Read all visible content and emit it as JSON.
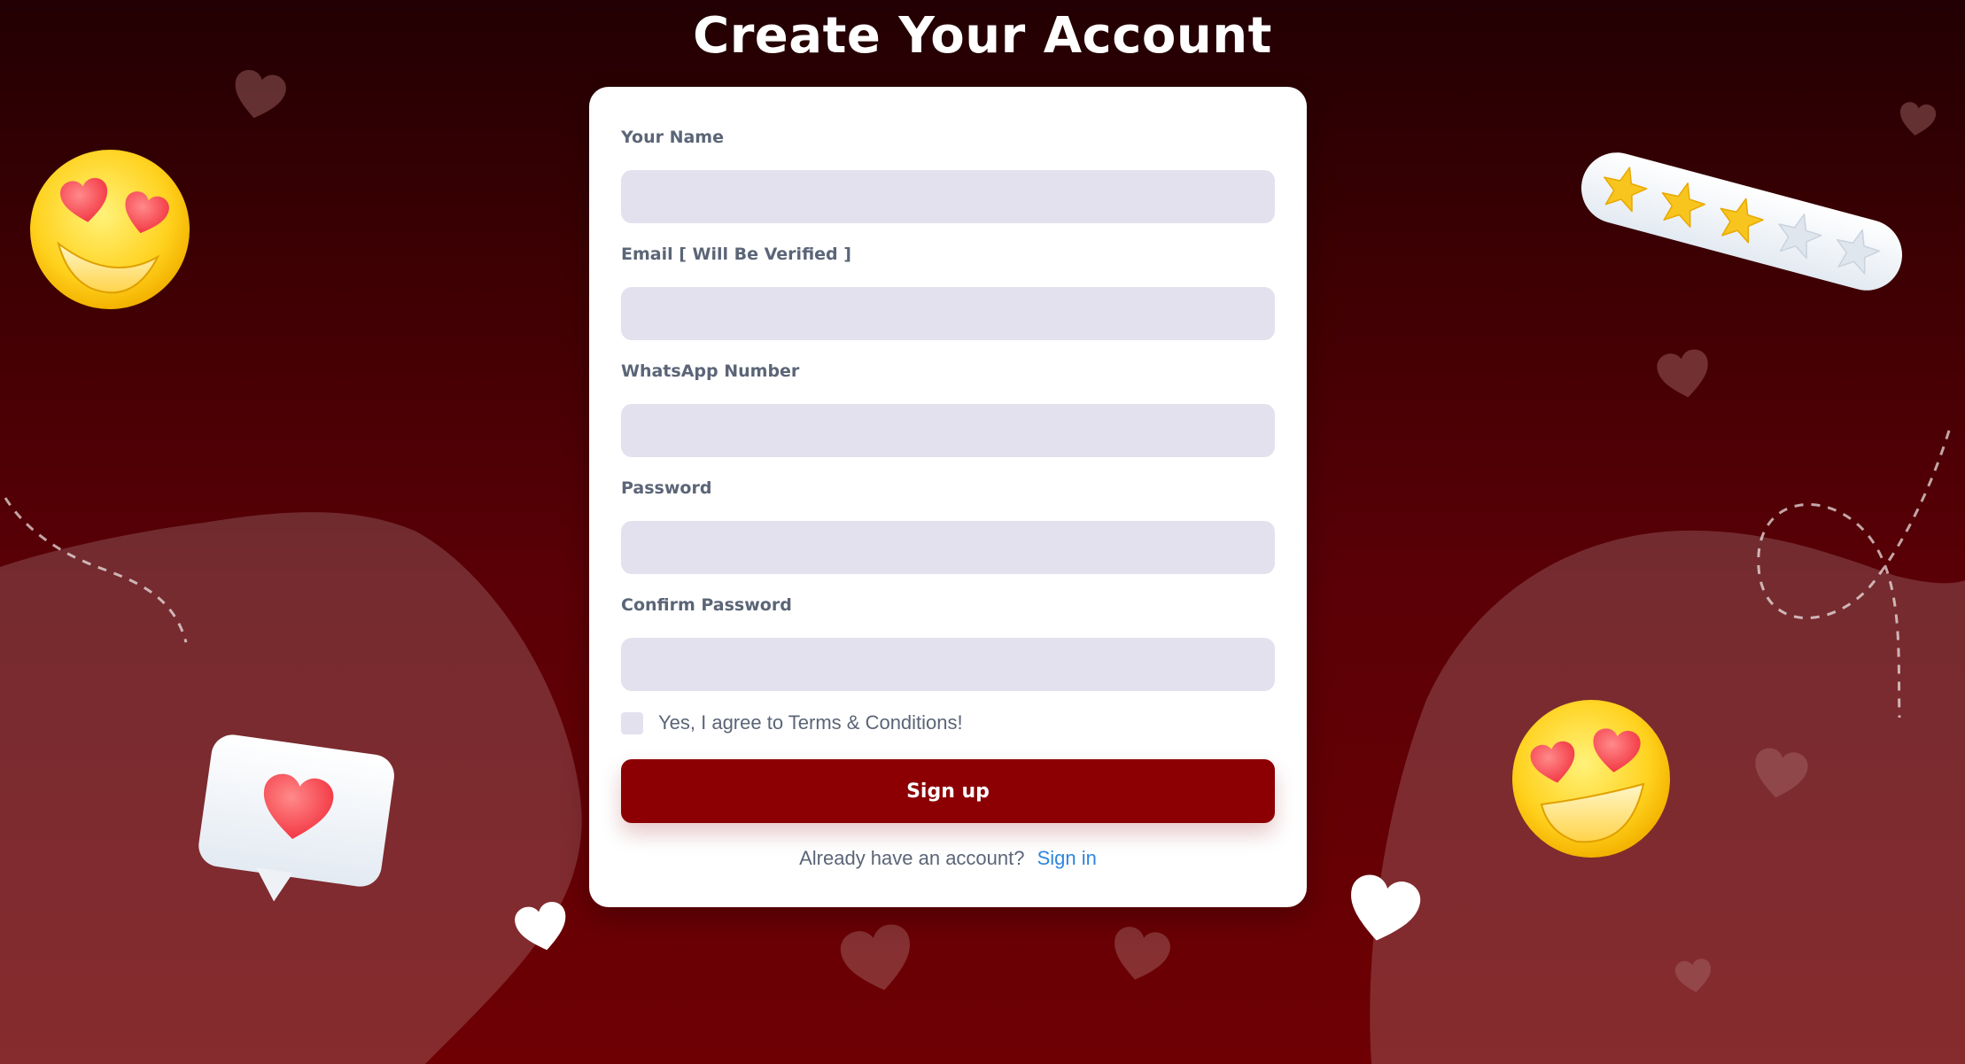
{
  "page": {
    "title": "Create Your Account"
  },
  "form": {
    "fields": [
      {
        "label": "Your Name",
        "value": "",
        "placeholder": "",
        "type": "text"
      },
      {
        "label": "Email [ Will Be Verified ]",
        "value": "",
        "placeholder": "",
        "type": "email"
      },
      {
        "label": "WhatsApp Number",
        "value": "",
        "placeholder": "",
        "type": "tel"
      },
      {
        "label": "Password",
        "value": "",
        "placeholder": "",
        "type": "password"
      },
      {
        "label": "Confirm Password",
        "value": "",
        "placeholder": "",
        "type": "password"
      }
    ],
    "terms_label": "Yes, I agree to Terms & Conditions!",
    "terms_checked": false,
    "submit_label": "Sign up",
    "signin_prompt": "Already have an account?",
    "signin_link": "Sign in"
  },
  "decor": {
    "rating_stars_filled": 3,
    "rating_stars_total": 5
  },
  "colors": {
    "background_top": "#220003",
    "background_bottom": "#6e0004",
    "primary_button": "#8c0003",
    "input_fill": "#e3e1ee",
    "label_text": "#5b6577",
    "link": "#2e86de",
    "star_filled": "#f7c51e",
    "star_empty": "#dfe6ee"
  },
  "icons": {
    "emoji_left": "heart-eyes-emoji-icon",
    "emoji_right": "heart-eyes-emoji-icon",
    "chat_bubble": "heart-chat-bubble-icon",
    "rating": "star-rating-icon",
    "floating": "heart-icon"
  }
}
